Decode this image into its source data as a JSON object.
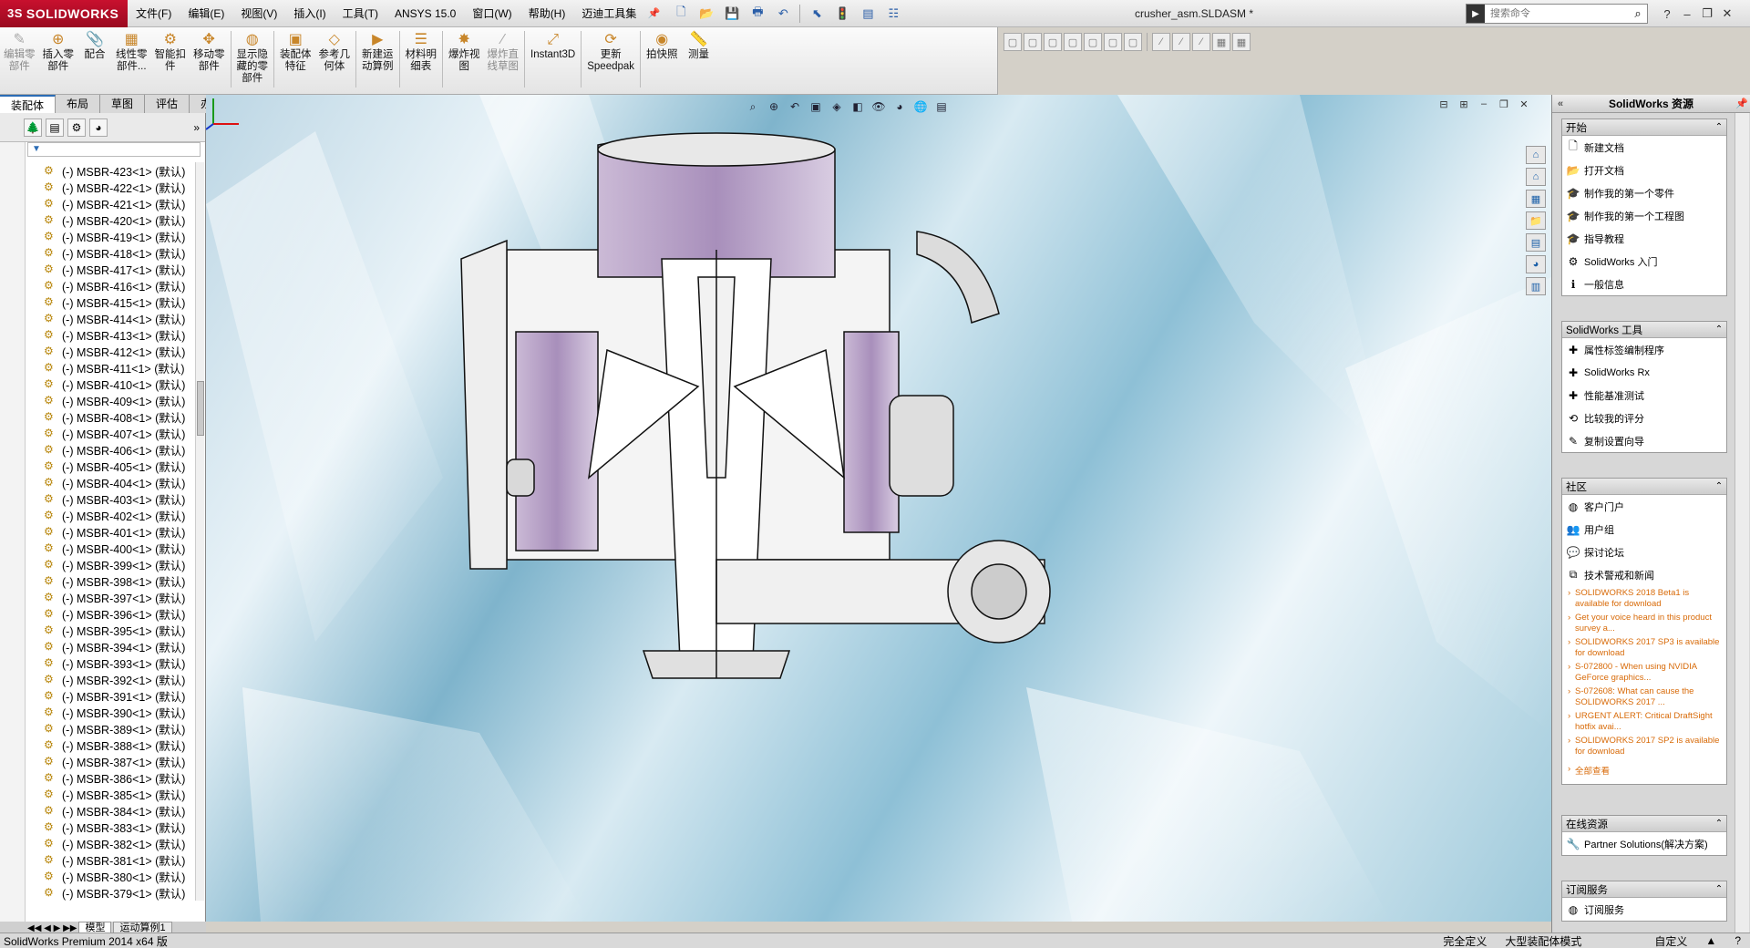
{
  "app": {
    "logo": "SOLIDWORKS",
    "logo_mark": "3S",
    "doc_title": "crusher_asm.SLDASM *"
  },
  "menus": [
    "文件(F)",
    "编辑(E)",
    "视图(V)",
    "插入(I)",
    "工具(T)",
    "ANSYS 15.0",
    "窗口(W)",
    "帮助(H)",
    "迈迪工具集"
  ],
  "search": {
    "placeholder": "搜索命令",
    "cmd_icon": "▶"
  },
  "window": {
    "help": "?",
    "minimize": "–",
    "restore": "❐",
    "close": "✕"
  },
  "command_tools": [
    {
      "label": "编辑零\n部件",
      "icon": "✎",
      "disabled": true
    },
    {
      "label": "插入零\n部件",
      "icon": "⊕",
      "disabled": false
    },
    {
      "label": "配合",
      "icon": "📎",
      "disabled": false
    },
    {
      "label": "线性零\n部件...",
      "icon": "▦",
      "disabled": false
    },
    {
      "label": "智能扣\n件",
      "icon": "⚙",
      "disabled": false
    },
    {
      "label": "移动零\n部件",
      "icon": "✥",
      "disabled": false
    },
    {
      "label": "显示隐\n藏的零\n部件",
      "icon": "◍",
      "disabled": false
    },
    {
      "label": "装配体\n特征",
      "icon": "▣",
      "disabled": false
    },
    {
      "label": "参考几\n何体",
      "icon": "◇",
      "disabled": false
    },
    {
      "label": "新建运\n动算例",
      "icon": "▶",
      "disabled": false
    },
    {
      "label": "材料明\n细表",
      "icon": "☰",
      "disabled": false
    },
    {
      "label": "爆炸视\n图",
      "icon": "✸",
      "disabled": false
    },
    {
      "label": "爆炸直\n线草图",
      "icon": "⁄",
      "disabled": true
    },
    {
      "label": "Instant3D",
      "icon": "⤢",
      "disabled": false
    },
    {
      "label": "更新\nSpeedpak",
      "icon": "⟳",
      "disabled": false
    },
    {
      "label": "拍快照",
      "icon": "◉",
      "disabled": false
    },
    {
      "label": "测量",
      "icon": "📏",
      "disabled": false
    }
  ],
  "cm_tabs": [
    "装配体",
    "布局",
    "草图",
    "评估",
    "办公室产品"
  ],
  "tree_items": [
    "(-) MSBR-423<1> (默认)",
    "(-) MSBR-422<1> (默认)",
    "(-) MSBR-421<1> (默认)",
    "(-) MSBR-420<1> (默认)",
    "(-) MSBR-419<1> (默认)",
    "(-) MSBR-418<1> (默认)",
    "(-) MSBR-417<1> (默认)",
    "(-) MSBR-416<1> (默认)",
    "(-) MSBR-415<1> (默认)",
    "(-) MSBR-414<1> (默认)",
    "(-) MSBR-413<1> (默认)",
    "(-) MSBR-412<1> (默认)",
    "(-) MSBR-411<1> (默认)",
    "(-) MSBR-410<1> (默认)",
    "(-) MSBR-409<1> (默认)",
    "(-) MSBR-408<1> (默认)",
    "(-) MSBR-407<1> (默认)",
    "(-) MSBR-406<1> (默认)",
    "(-) MSBR-405<1> (默认)",
    "(-) MSBR-404<1> (默认)",
    "(-) MSBR-403<1> (默认)",
    "(-) MSBR-402<1> (默认)",
    "(-) MSBR-401<1> (默认)",
    "(-) MSBR-400<1> (默认)",
    "(-) MSBR-399<1> (默认)",
    "(-) MSBR-398<1> (默认)",
    "(-) MSBR-397<1> (默认)",
    "(-) MSBR-396<1> (默认)",
    "(-) MSBR-395<1> (默认)",
    "(-) MSBR-394<1> (默认)",
    "(-) MSBR-393<1> (默认)",
    "(-) MSBR-392<1> (默认)",
    "(-) MSBR-391<1> (默认)",
    "(-) MSBR-390<1> (默认)",
    "(-) MSBR-389<1> (默认)",
    "(-) MSBR-388<1> (默认)",
    "(-) MSBR-387<1> (默认)",
    "(-) MSBR-386<1> (默认)",
    "(-) MSBR-385<1> (默认)",
    "(-) MSBR-384<1> (默认)",
    "(-) MSBR-383<1> (默认)",
    "(-) MSBR-382<1> (默认)",
    "(-) MSBR-381<1> (默认)",
    "(-) MSBR-380<1> (默认)",
    "(-) MSBR-379<1> (默认)"
  ],
  "bottom_tabs": [
    "模型",
    "运动算例1"
  ],
  "taskpane": {
    "title": "SolidWorks 资源",
    "groups": [
      {
        "title": "开始",
        "items": [
          {
            "icon": "🗋",
            "label": "新建文档"
          },
          {
            "icon": "📂",
            "label": "打开文档"
          },
          {
            "icon": "🎓",
            "label": "制作我的第一个零件"
          },
          {
            "icon": "🎓",
            "label": "制作我的第一个工程图"
          },
          {
            "icon": "🎓",
            "label": "指导教程"
          },
          {
            "icon": "⚙",
            "label": "SolidWorks 入门"
          },
          {
            "icon": "ℹ",
            "label": "一般信息"
          }
        ]
      },
      {
        "title": "SolidWorks 工具",
        "items": [
          {
            "icon": "✚",
            "label": "属性标签编制程序"
          },
          {
            "icon": "✚",
            "label": "SolidWorks Rx"
          },
          {
            "icon": "✚",
            "label": "性能基准测试"
          },
          {
            "icon": "⟲",
            "label": "比较我的评分"
          },
          {
            "icon": "✎",
            "label": "复制设置向导"
          }
        ]
      },
      {
        "title": "社区",
        "items": [
          {
            "icon": "◍",
            "label": "客户门户"
          },
          {
            "icon": "👥",
            "label": "用户组"
          },
          {
            "icon": "💬",
            "label": "探讨论坛"
          },
          {
            "icon": "⧉",
            "label": "技术警戒和新闻"
          }
        ],
        "news": [
          "SOLIDWORKS 2018 Beta1 is available for download",
          "Get your voice heard in this product survey a...",
          "SOLIDWORKS 2017 SP3 is available for download",
          "S-072800 - When using NVIDIA GeForce graphics...",
          "S-072608: What can cause the SOLIDWORKS 2017 ...",
          "URGENT ALERT: Critical DraftSight hotfix avai...",
          "SOLIDWORKS 2017 SP2 is available for download"
        ],
        "more": "全部查看"
      },
      {
        "title": "在线资源",
        "items": [
          {
            "icon": "🔧",
            "label": "Partner Solutions(解决方案)"
          }
        ]
      },
      {
        "title": "订阅服务",
        "items": [
          {
            "icon": "◍",
            "label": "订阅服务"
          }
        ]
      }
    ]
  },
  "status": {
    "left": "SolidWorks Premium 2014 x64 版",
    "s1": "完全定义",
    "s2": "大型装配体模式",
    "s3": "自定义",
    "s4": "▲",
    "s5": "?"
  },
  "colors": {
    "accent": "#2b6cb5",
    "brand": "#c8102e",
    "link": "#d86a08",
    "part_shade": "#b59cc4"
  }
}
